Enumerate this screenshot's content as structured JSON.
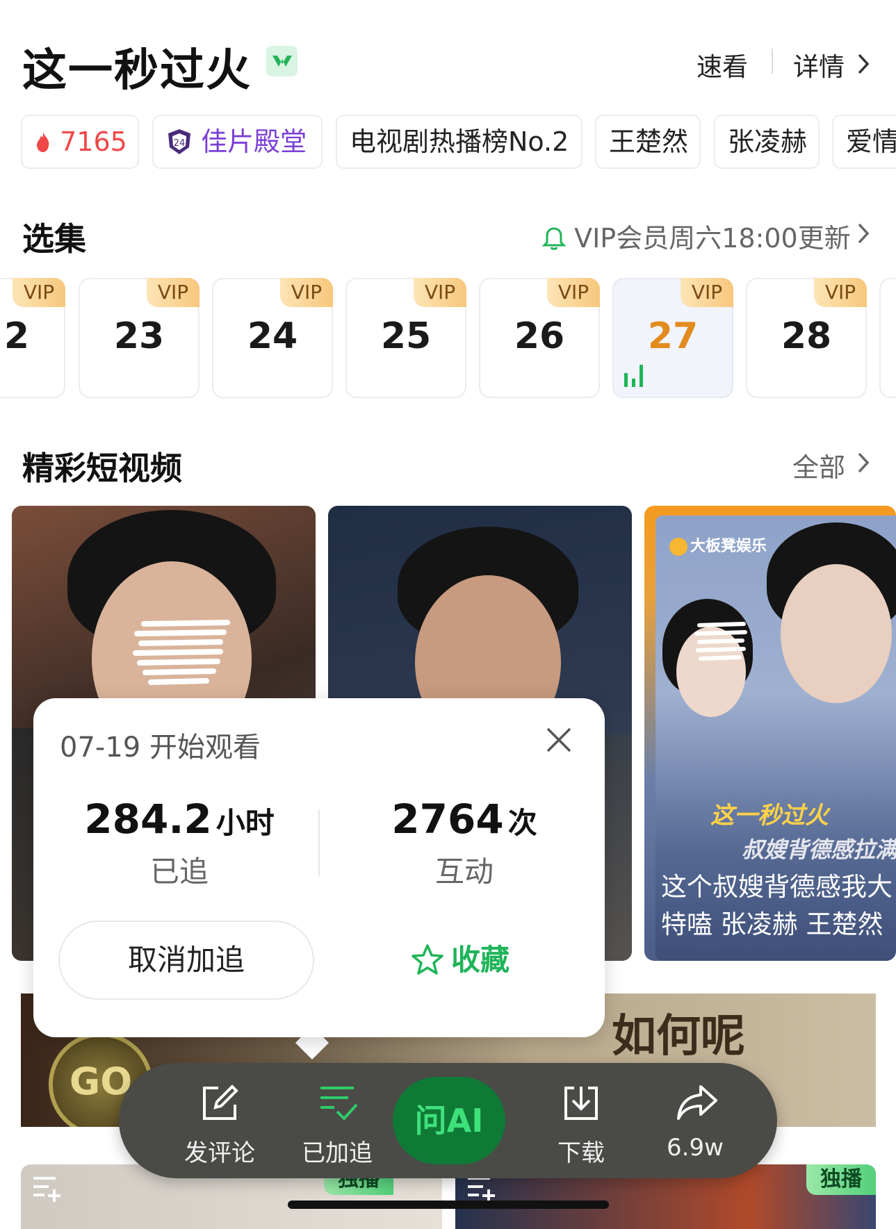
{
  "header": {
    "title": "这一秒过火",
    "quick_view": "速看",
    "details": "详情"
  },
  "tags": [
    {
      "label": "7165",
      "type": "heat"
    },
    {
      "label": "佳片殿堂",
      "type": "hall"
    },
    {
      "label": "电视剧热播榜No.2",
      "type": "plain"
    },
    {
      "label": "王楚然",
      "type": "plain"
    },
    {
      "label": "张凌赫",
      "type": "plain"
    },
    {
      "label": "爱情",
      "type": "plain"
    }
  ],
  "episodes_section": {
    "title": "选集",
    "update_note": "VIP会员周六18:00更新",
    "episodes": [
      {
        "num": "2",
        "badge": "VIP",
        "active": false
      },
      {
        "num": "23",
        "badge": "VIP",
        "active": false
      },
      {
        "num": "24",
        "badge": "VIP",
        "active": false
      },
      {
        "num": "25",
        "badge": "VIP",
        "active": false
      },
      {
        "num": "26",
        "badge": "VIP",
        "active": false
      },
      {
        "num": "27",
        "badge": "VIP",
        "active": true
      },
      {
        "num": "28",
        "badge": "VIP",
        "active": false
      }
    ]
  },
  "clips_section": {
    "title": "精彩短视频",
    "all_link": "全部",
    "clip3": {
      "brand": "大板凳娱乐",
      "overlay_title": "这一秒过火",
      "overlay_sub": "叔嫂背德感拉满",
      "caption_line1": "这个叔嫂背德感我大",
      "caption_line2": "特嗑 张凌赫 王楚然"
    }
  },
  "banner": {
    "coin_text": "GO",
    "headline": "如何呢"
  },
  "cards": [
    {
      "badge": "独播"
    },
    {
      "badge": "独播"
    }
  ],
  "popup": {
    "start_date": "07-19 开始观看",
    "hours_value": "284.2",
    "hours_unit": "小时",
    "hours_label": "已追",
    "interactions_value": "2764",
    "interactions_unit": "次",
    "interactions_label": "互动",
    "cancel_label": "取消加追",
    "favorite_label": "收藏"
  },
  "action_bar": {
    "comment": "发评论",
    "followed": "已加追",
    "ask_ai": "问AI",
    "download": "下载",
    "share_count": "6.9w"
  },
  "colors": {
    "accent_green": "#1fb459",
    "heat_red": "#f04848",
    "hall_purple": "#7b3fd6",
    "active_episode": "#e28b1e"
  }
}
